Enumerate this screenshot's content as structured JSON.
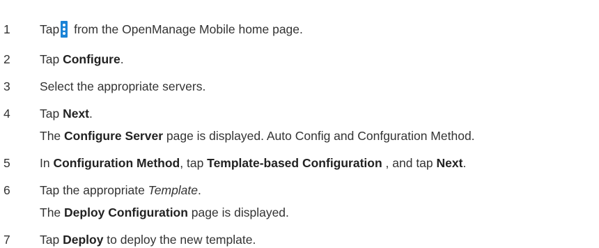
{
  "steps": [
    {
      "num": "1",
      "before": "Tap",
      "icon": "vertical-ellipsis-menu-icon",
      "after": " from the OpenManage Mobile home page."
    },
    {
      "num": "2",
      "pre": "Tap ",
      "bold": "Configure",
      "post": "."
    },
    {
      "num": "3",
      "text": "Select the appropriate servers."
    },
    {
      "num": "4",
      "pre": "Tap ",
      "bold": "Next",
      "post": "."
    },
    {
      "pre": "The ",
      "bold": "Configure Server",
      "post": " page is displayed. Auto Config and Confguration Method."
    },
    {
      "num": "5",
      "pre": "In ",
      "bold1": "Configuration Method",
      "mid1": ", tap ",
      "bold2": "Template-based Configuration",
      "mid2": " , and tap ",
      "bold3": "Next",
      "post": "."
    },
    {
      "num": "6",
      "pre": "Tap the appropriate ",
      "italic": "Template",
      "post": "."
    },
    {
      "pre": "The ",
      "bold": "Deploy Configuration",
      "post": " page is displayed."
    },
    {
      "num": "7",
      "pre": "Tap ",
      "bold": "Deploy",
      "post": " to deploy the new template."
    }
  ],
  "colors": {
    "text": "#333333",
    "icon_blue": "#1a83d6"
  }
}
